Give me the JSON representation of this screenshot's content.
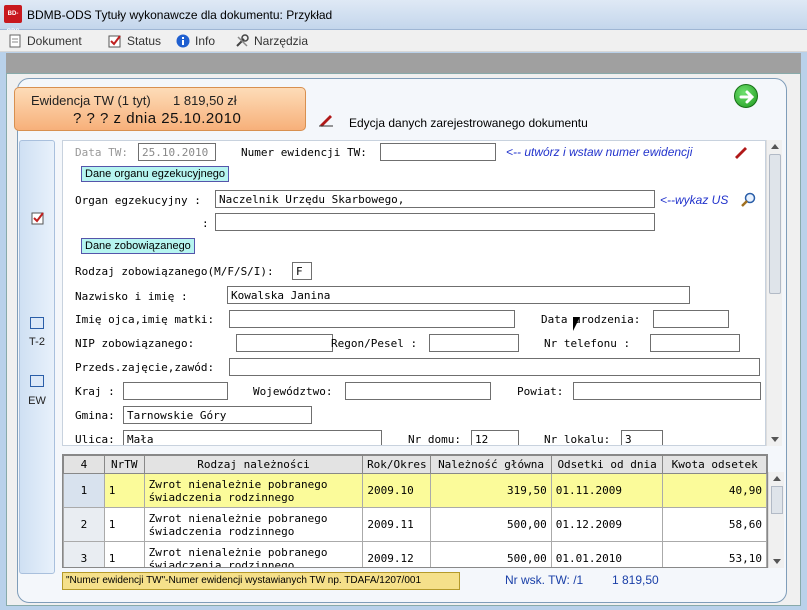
{
  "window": {
    "title": "BDMB-ODS  Tytuły wykonawcze dla dokumentu: Przykład",
    "app_icon_text": "BD-ODS"
  },
  "menu": {
    "items": [
      {
        "label": "Dokument",
        "icon": "document-icon"
      },
      {
        "label": "Status",
        "icon": "checklist-icon"
      },
      {
        "label": "Info",
        "icon": "info-icon"
      },
      {
        "label": "Narzędzia",
        "icon": "tools-icon"
      }
    ]
  },
  "header": {
    "line1": "Ewidencja TW (1 tyt)",
    "amount": "1 819,50 zł",
    "line2": "? ? ?  z dnia 25.10.2010",
    "edit_label": "Edycja danych  zarejestrowanego dokumentu"
  },
  "sidebar": {
    "t2_label": "T-2",
    "ew_label": "EW"
  },
  "form": {
    "data_tw_label": "Data TW:",
    "data_tw_value": "25.10.2010",
    "numer_ew_label": "Numer ewidencji TW:",
    "numer_ew_value": "",
    "create_hint": "<-- utwórz i wstaw numer  ewidencji",
    "organ_button": "Dane organu egzekucyjnego",
    "organ_label": "Organ egzekucyjny :",
    "organ_value": "Naczelnik Urzędu Skarbowego,",
    "organ_value2": "",
    "organ_colon": ":",
    "us_hint": "<--wykaz US",
    "zobow_button": "Dane zobowiązanego",
    "rodzaj_label": "Rodzaj zobowiązanego(M/F/S/I):",
    "rodzaj_value": "F",
    "nazwisko_label": "Nazwisko i imię    :",
    "nazwisko_value": "Kowalska Janina",
    "imie_ojca_label": "Imię ojca,imię matki:",
    "imie_ojca_value": "",
    "data_ur_label": "Data urodzenia:",
    "data_ur_value": "",
    "nip_label": "NIP zobowiązanego:",
    "nip_value": "",
    "regon_label": "Regon/Pesel :",
    "regon_value": "",
    "tel_label": "Nr telefonu  :",
    "tel_value": "",
    "przeds_label": "Przeds.zajęcie,zawód:",
    "przeds_value": "",
    "kraj_label": "Kraj  :",
    "kraj_value": "",
    "woj_label": "Województwo:",
    "woj_value": "",
    "powiat_label": "Powiat:",
    "powiat_value": "",
    "gmina_label": "Gmina:",
    "gmina_value": "Tarnowskie Góry",
    "ulica_label": "Ulica:",
    "ulica_value": "Mała",
    "nr_domu_label": "Nr domu:",
    "nr_domu_value": "12",
    "nr_lokalu_label": "Nr lokalu:",
    "nr_lokalu_value": "3"
  },
  "table": {
    "headers": [
      "4",
      "NrTW",
      "Rodzaj należności",
      "Rok/Okres",
      "Należność główna",
      "Odsetki od dnia",
      "Kwota odsetek"
    ],
    "rows": [
      {
        "idx": "1",
        "nrtw": "1",
        "rodzaj1": "Zwrot nienależnie pobranego",
        "rodzaj2": "świadczenia rodzinnego",
        "rok": "2009.10",
        "naleznosc": "319,50",
        "odsetki_od": "01.11.2009",
        "kwota": "40,90"
      },
      {
        "idx": "2",
        "nrtw": "1",
        "rodzaj1": "Zwrot nienależnie pobranego",
        "rodzaj2": "świadczenia rodzinnego",
        "rok": "2009.11",
        "naleznosc": "500,00",
        "odsetki_od": "01.12.2009",
        "kwota": "58,60"
      },
      {
        "idx": "3",
        "nrtw": "1",
        "rodzaj1": "Zwrot nienależnie pobranego",
        "rodzaj2": "świadczenia rodzinnego",
        "rok": "2009.12",
        "naleznosc": "500,00",
        "odsetki_od": "01.01.2010",
        "kwota": "53,10"
      }
    ]
  },
  "footer": {
    "note": "\"Numer ewidencji TW\"-Numer ewidencji wystawianych TW  np. TDAFA/1207/001",
    "nr_wsk": "Nr wsk. TW: /1",
    "sum": "1 819,50"
  }
}
